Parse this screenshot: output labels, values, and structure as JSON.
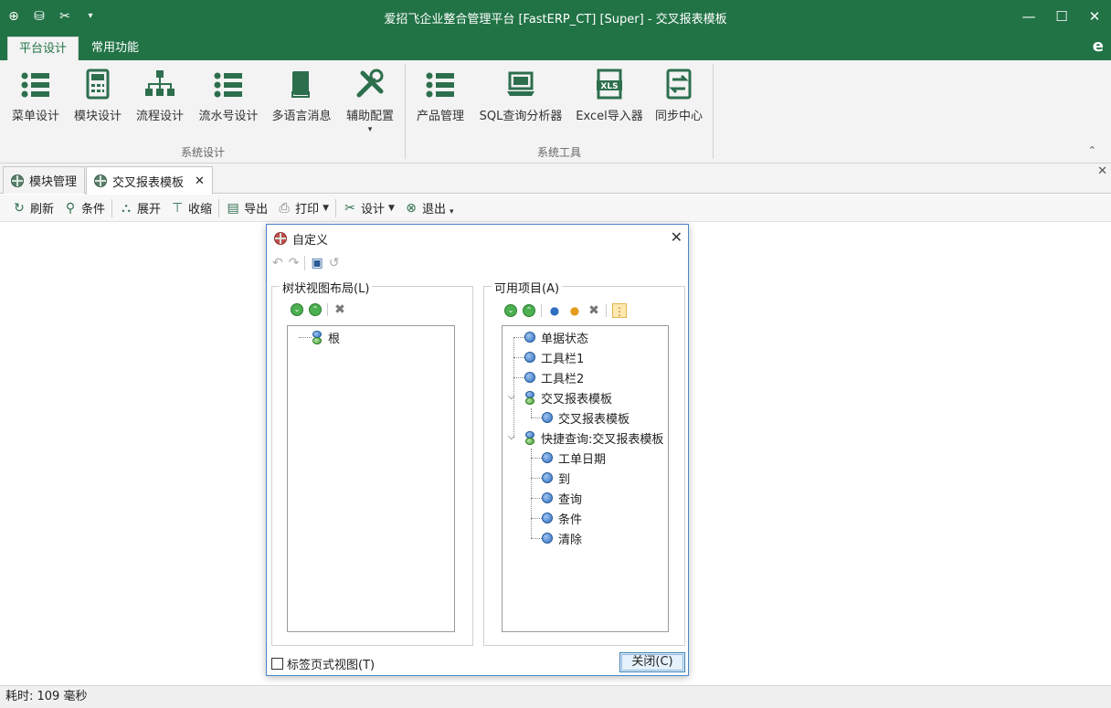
{
  "window": {
    "title": "爱招飞企业整合管理平台 [FastERP_CT] [Super] - 交叉报表模板",
    "qa_icons": [
      "globe-icon",
      "database-icon",
      "tools-icon",
      "dropdown-icon"
    ]
  },
  "ribbon": {
    "tabs": [
      {
        "label": "平台设计",
        "active": true
      },
      {
        "label": "常用功能",
        "active": false
      }
    ],
    "groups": [
      {
        "label": "系统设计",
        "buttons": [
          {
            "label": "菜单设计",
            "icon": "list-icon"
          },
          {
            "label": "模块设计",
            "icon": "calculator-icon"
          },
          {
            "label": "流程设计",
            "icon": "org-chart-icon"
          },
          {
            "label": "流水号设计",
            "icon": "numbered-list-icon"
          },
          {
            "label": "多语言消息",
            "icon": "book-icon"
          },
          {
            "label": "辅助配置",
            "icon": "tools-icon"
          }
        ]
      },
      {
        "label": "系统工具",
        "buttons": [
          {
            "label": "产品管理",
            "icon": "list-icon"
          },
          {
            "label": "SQL查询分析器",
            "icon": "laptop-icon"
          },
          {
            "label": "Excel导入器",
            "icon": "excel-icon"
          },
          {
            "label": "同步中心",
            "icon": "sync-icon"
          }
        ]
      }
    ]
  },
  "doc_tabs": [
    {
      "label": "模块管理",
      "active": false
    },
    {
      "label": "交叉报表模板",
      "active": true
    }
  ],
  "toolbar": {
    "refresh": "刷新",
    "condition": "条件",
    "expand": "展开",
    "collapse": "收缩",
    "export": "导出",
    "print": "打印",
    "design": "设计",
    "exit": "退出"
  },
  "dialog": {
    "title": "自定义",
    "left_panel": {
      "legend": "树状视图布局(L)",
      "nodes": [
        {
          "label": "根"
        }
      ]
    },
    "right_panel": {
      "legend": "可用项目(A)",
      "nodes": [
        {
          "label": "单据状态",
          "level": 0
        },
        {
          "label": "工具栏1",
          "level": 0
        },
        {
          "label": "工具栏2",
          "level": 0
        },
        {
          "label": "交叉报表模板",
          "level": 0,
          "expanded": true
        },
        {
          "label": "交叉报表模板",
          "level": 1
        },
        {
          "label": "快捷查询:交叉报表模板",
          "level": 0,
          "expanded": true
        },
        {
          "label": "工单日期",
          "level": 1
        },
        {
          "label": "到",
          "level": 1
        },
        {
          "label": "查询",
          "level": 1
        },
        {
          "label": "条件",
          "level": 1
        },
        {
          "label": "清除",
          "level": 1
        }
      ]
    },
    "tab_view_checkbox": "标签页式视图(T)",
    "close_button": "关闭(C)"
  },
  "status": {
    "text": "耗时: 109 毫秒"
  },
  "colors": {
    "brand": "#217346",
    "ribbon_bg": "#f3f3f3",
    "dialog_border": "#4a86c7"
  }
}
